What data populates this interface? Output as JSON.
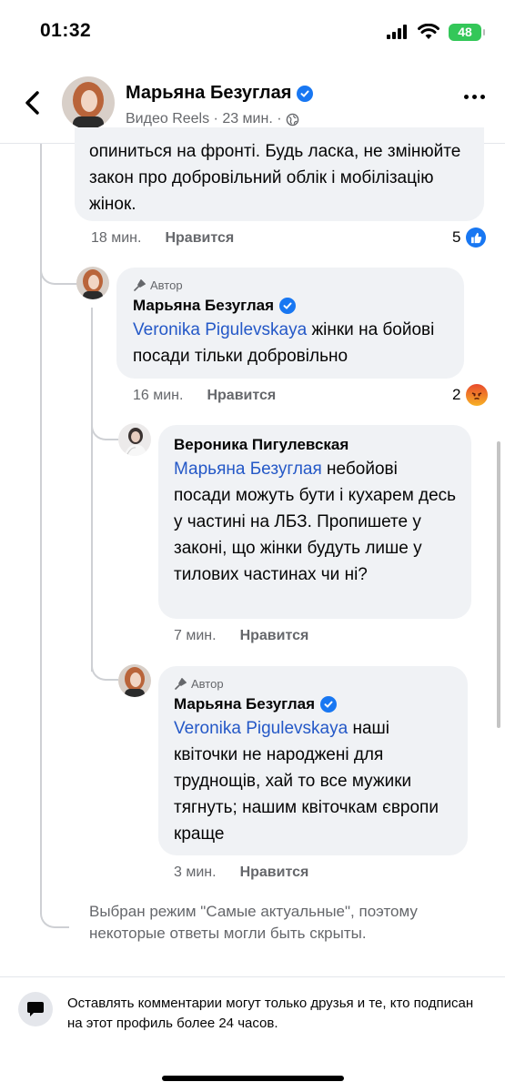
{
  "status_bar": {
    "time": "01:32",
    "battery": "48"
  },
  "header": {
    "name": "Марьяна Безуглая",
    "subtitle": "Видео Reels · 23 мин. ·"
  },
  "comments": [
    {
      "text": "опиниться на фронті. Будь ласка, не змінюйте закон про добровільний облік і мобілізацію жінок.",
      "time": "18 мин.",
      "like_label": "Нравится",
      "reaction_count": "5",
      "reaction_type": "like"
    },
    {
      "author_tag": "Автор",
      "name": "Марьяна Безуглая",
      "mention": "Veronika  Pigulevskaya",
      "text": " жінки на бойові посади тільки добровільно",
      "time": "16 мин.",
      "like_label": "Нравится",
      "reaction_count": "2",
      "reaction_type": "angry"
    },
    {
      "name": "Вероника Пигулевская",
      "mention": "Марьяна Безуглая",
      "text": " небойові посади можуть бути і кухарем десь у частині на ЛБЗ. Пропишете у законі, що жінки будуть лише у тилових частинах чи ні?",
      "time": "7 мин.",
      "like_label": "Нравится"
    },
    {
      "author_tag": "Автор",
      "name": "Марьяна Безуглая",
      "mention": "Veronika  Pigulevskaya",
      "text": " наші квіточки не народжені для труднощів, хай то все мужики тягнуть; нашим квіточкам європи краще",
      "time": "3 мин.",
      "like_label": "Нравится"
    }
  ],
  "filter_note": "Выбран режим \"Самые актуальные\", поэтому некоторые ответы могли быть скрыты.",
  "footer_notice": "Оставлять комментарии могут только друзья и те, кто подписан на этот профиль более 24 часов.",
  "colors": {
    "accent": "#1877f2",
    "mention": "#2458c7",
    "bubble": "#f0f2f5",
    "battery": "#34c759"
  }
}
